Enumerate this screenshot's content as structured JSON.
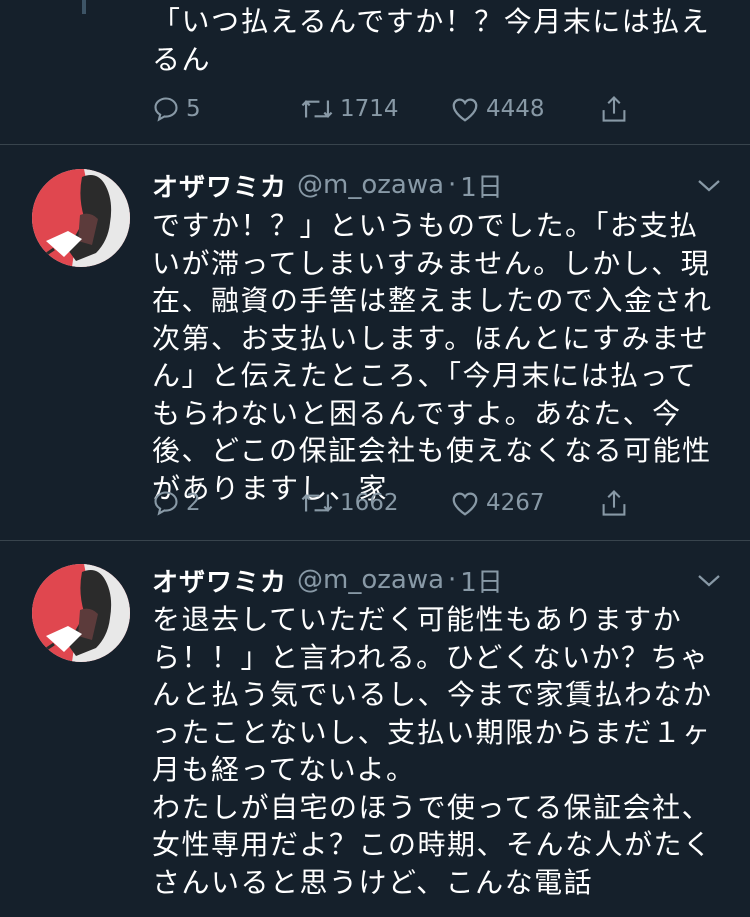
{
  "tweets": [
    {
      "text": "「いつ払えるんですか！？今月末には払えるん",
      "actions": {
        "replies": "5",
        "retweets": "1714",
        "likes": "4448"
      }
    },
    {
      "name": "オザワミカ",
      "handle": "@m_ozawa",
      "separator": "·",
      "time": "1日",
      "text": "ですか！？」というものでした。「お支払いが滞ってしまいすみません。しかし、現在、融資の手筈は整えましたので入金され次第、お支払いします。ほんとにすみません」と伝えたところ、「今月末には払ってもらわないと困るんですよ。あなた、今後、どこの保証会社も使えなくなる可能性がありますし、家",
      "actions": {
        "replies": "2",
        "retweets": "1662",
        "likes": "4267"
      }
    },
    {
      "name": "オザワミカ",
      "handle": "@m_ozawa",
      "separator": "·",
      "time": "1日",
      "text": "を退去していただく可能性もありますから！！」と言われる。ひどくないか？ちゃんと払う気でいるし、今まで家賃払わなかったことないし、支払い期限からまだ１ヶ月も経ってないよ。\nわたしが自宅のほうで使ってる保証会社、女性専用だよ？この時期、そんな人がたくさんいると思うけど、こんな電話"
    }
  ],
  "icons": [
    "reply-icon",
    "retweet-icon",
    "like-icon",
    "share-icon",
    "chevron-down-icon"
  ],
  "colors": {
    "background": "#15202b",
    "secondary_text": "#8899a6",
    "avatar_red": "#e0474f"
  }
}
